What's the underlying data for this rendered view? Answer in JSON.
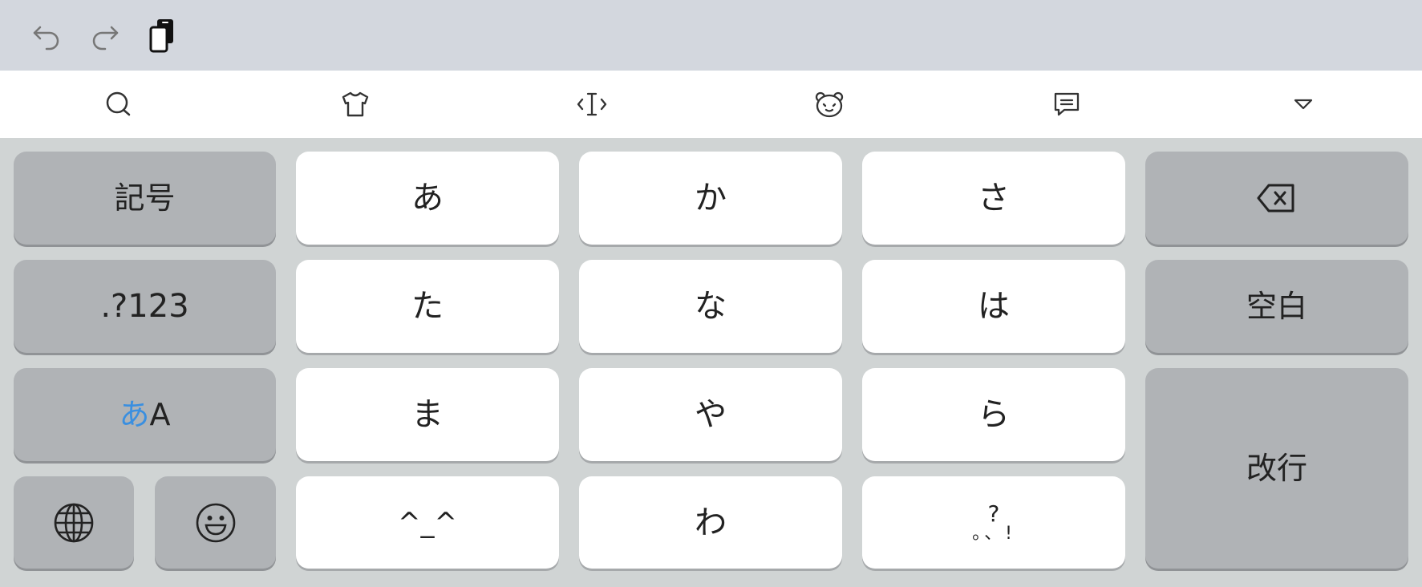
{
  "topbar": {
    "undo_icon": "undo-icon",
    "redo_icon": "redo-icon",
    "clipboard_icon": "clipboard-icon"
  },
  "toolbar": {
    "items": [
      "search-icon",
      "theme-shirt-icon",
      "cursor-move-icon",
      "kaomoji-bear-icon",
      "fixed-phrase-icon",
      "collapse-triangle-icon"
    ]
  },
  "keys": {
    "symbols": "記号",
    "numbers": ".?123",
    "mode_kana": "あ",
    "mode_alpha": "A",
    "a": "あ",
    "ka": "か",
    "sa": "さ",
    "ta": "た",
    "na": "な",
    "ha": "は",
    "ma": "ま",
    "ya": "や",
    "ra": "ら",
    "kaomoji": "^_^",
    "wa": "わ",
    "punct_top": "?",
    "punct_bottom": "。、!",
    "space": "空白",
    "enter": "改行"
  },
  "colors": {
    "accent": "#3a8fe0",
    "key_white": "#ffffff",
    "key_gray": "#b0b3b6",
    "background": "#d0d4d4"
  }
}
